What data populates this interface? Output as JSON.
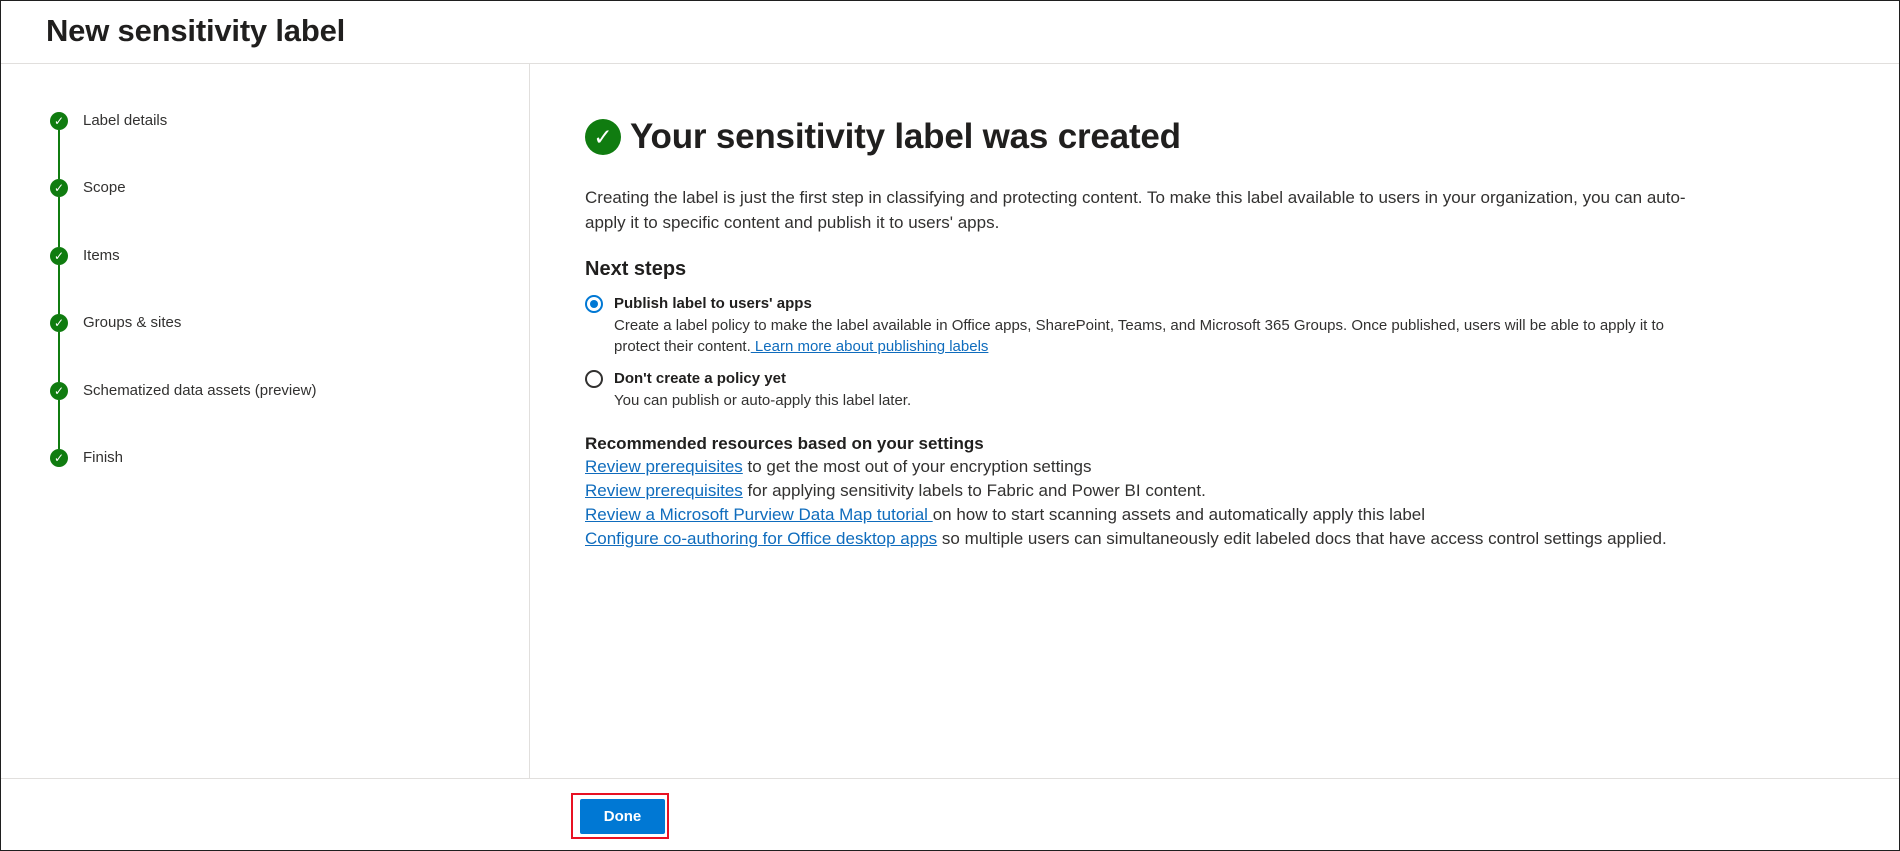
{
  "header": {
    "title": "New sensitivity label"
  },
  "sidebar": {
    "steps": [
      {
        "label": "Label details",
        "status": "completed",
        "icon": "check-icon"
      },
      {
        "label": "Scope",
        "status": "completed",
        "icon": "check-icon"
      },
      {
        "label": "Items",
        "status": "completed",
        "icon": "check-icon"
      },
      {
        "label": "Groups & sites",
        "status": "completed",
        "icon": "check-icon"
      },
      {
        "label": "Schematized data assets (preview)",
        "status": "completed",
        "icon": "check-icon"
      },
      {
        "label": "Finish",
        "status": "completed",
        "icon": "check-icon"
      }
    ]
  },
  "main": {
    "title": "Your sensitivity label was created",
    "title_icon": "success-check-icon",
    "intro": "Creating the label is just the first step in classifying and protecting content. To make this label available to users in your organization, you can auto-apply it to specific content and publish it to users' apps.",
    "next_steps": {
      "heading": "Next steps",
      "options": [
        {
          "title": "Publish label to users' apps",
          "selected": true,
          "description": "Create a label policy to make the label available in Office apps, SharePoint, Teams, and Microsoft 365 Groups. Once published, users will be able to apply it to protect their content.",
          "link": " Learn more about publishing labels"
        },
        {
          "title": "Don't create a policy yet",
          "selected": false,
          "description": "You can publish or auto-apply this label later."
        }
      ]
    },
    "resources": {
      "heading": "Recommended resources based on your settings",
      "items": [
        {
          "link": "Review prerequisites",
          "text": " to get the most out of your encryption settings"
        },
        {
          "link": "Review prerequisites",
          "text": " for applying sensitivity labels to Fabric and Power BI content."
        },
        {
          "link": "Review a Microsoft Purview Data Map tutorial ",
          "text": "on how to start scanning assets and automatically apply this label"
        },
        {
          "link": "Configure co-authoring for Office desktop apps",
          "text": " so multiple users can simultaneously edit labeled docs that have access control settings applied."
        }
      ]
    }
  },
  "footer": {
    "done_label": "Done"
  },
  "colors": {
    "success_green": "#107c10",
    "primary_blue": "#0078d4",
    "link_blue": "#0f6cbd",
    "highlight_red": "#e81123"
  }
}
